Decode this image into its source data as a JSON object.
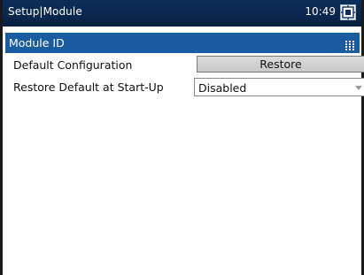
{
  "titlebar": {
    "title": "Setup|Module",
    "time": "10:49",
    "status_icon": "device-status-icon"
  },
  "section": {
    "label": "Module ID",
    "icon": "grid-icon"
  },
  "settings": {
    "default_configuration": {
      "label": "Default Configuration",
      "button_label": "Restore"
    },
    "restore_at_startup": {
      "label": "Restore Default at Start-Up",
      "selected_value": "Disabled"
    }
  },
  "colors": {
    "titlebar_bg": "#0a2850",
    "section_bg": "#1b5ba0",
    "button_bg": "#d0d0d0"
  }
}
